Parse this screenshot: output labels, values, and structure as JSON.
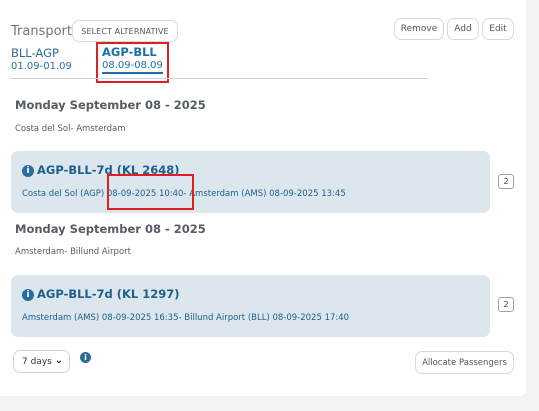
{
  "header": {
    "title": "Transport",
    "select_alternative": "SELECT ALTERNATIVE",
    "remove": "Remove",
    "add": "Add",
    "edit": "Edit"
  },
  "tabs": [
    {
      "name": "BLL-AGP",
      "dates": "01.09-01.09"
    },
    {
      "name": "AGP-BLL",
      "dates": "08.09-08.09"
    }
  ],
  "segments": [
    {
      "date_heading": "Monday September 08 - 2025",
      "route": "Costa del Sol- Amsterdam",
      "flight_code": "AGP-BLL-7d (KL 2648)",
      "details": "Costa del Sol (AGP) 08-09-2025 10:40- Amsterdam (AMS) 08-09-2025 13:45",
      "count": "2"
    },
    {
      "date_heading": "Monday September 08 - 2025",
      "route": "Amsterdam- Billund Airport",
      "flight_code": "AGP-BLL-7d (KL 1297)",
      "details": "Amsterdam (AMS) 08-09-2025 16:35- Billund Airport (BLL) 08-09-2025 17:40",
      "count": "2"
    }
  ],
  "footer": {
    "duration_select": "7 days",
    "allocate": "Allocate Passengers"
  },
  "icons": {
    "info": "info-icon",
    "chevron": "chevron-down-icon"
  },
  "colors": {
    "accent": "#1e6fa3",
    "flight_bg": "#dce6ed",
    "highlight": "#e02020"
  }
}
